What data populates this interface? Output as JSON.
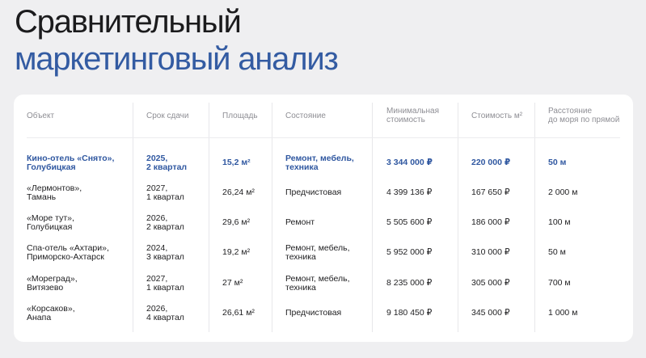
{
  "title": {
    "line1": "Сравнительный",
    "line2": "маркетинговый анализ"
  },
  "colors": {
    "background": "#efeff1",
    "title_dark": "#1b1b1d",
    "title_accent": "#335ba2",
    "highlight": "#2f57a0"
  },
  "table": {
    "headers": [
      "Объект",
      "Срок сдачи",
      "Площадь",
      "Состояние",
      "Минимальная\nстоимость",
      "Стоимость м²",
      "Расстояние\nдо моря по прямой"
    ],
    "rows": [
      [
        "Кино-отель «Снято»,\nГолубицкая",
        "2025,\n2 квартал",
        "15,2 м²",
        "Ремонт, мебель,\nтехника",
        "3 344 000 ₽",
        "220 000 ₽",
        "50 м"
      ],
      [
        "«Лермонтов»,\nТамань",
        "2027,\n1 квартал",
        "26,24 м²",
        "Предчистовая",
        "4 399 136 ₽",
        "167 650 ₽",
        "2 000 м"
      ],
      [
        "«Море тут»,\nГолубицкая",
        "2026,\n2 квартал",
        "29,6 м²",
        "Ремонт",
        "5 505 600 ₽",
        "186 000 ₽",
        "100 м"
      ],
      [
        "Спа-отель «Ахтари»,\nПриморско-Ахтарск",
        "2024,\n3 квартал",
        "19,2 м²",
        "Ремонт, мебель,\nтехника",
        "5 952 000 ₽",
        "310 000 ₽",
        "50 м"
      ],
      [
        "«Мореград»,\nВитязево",
        "2027,\n1 квартал",
        "27 м²",
        "Ремонт, мебель,\nтехника",
        "8 235 000 ₽",
        "305 000 ₽",
        "700 м"
      ],
      [
        "«Корсаков»,\nАнапа",
        "2026,\n4 квартал",
        "26,61 м²",
        "Предчистовая",
        "9 180 450 ₽",
        "345 000 ₽",
        "1 000 м"
      ]
    ]
  }
}
